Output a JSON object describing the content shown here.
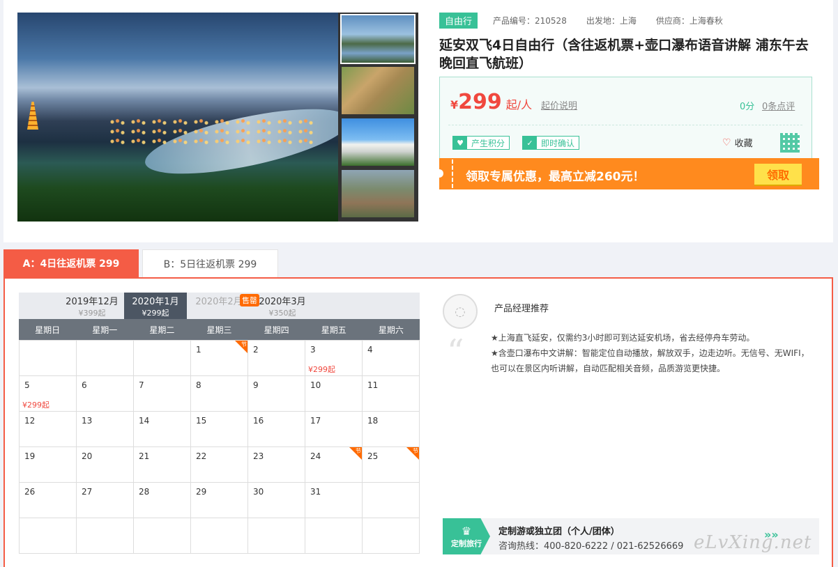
{
  "product": {
    "tag": "自由行",
    "code": "产品编号：210528",
    "departure": "出发地：上海",
    "supplier": "供应商：上海春秋",
    "title": "延安双飞4日自由行（含往返机票+壶口瀑布语音讲解 浦东午去晚回直飞航班）"
  },
  "price": {
    "currency": "¥",
    "amount": "299",
    "unit": "起/人",
    "note": "起价说明",
    "score": "0分",
    "reviews": "0条点评",
    "badge1": "产生积分",
    "badge2": "即时确认",
    "favorite": "收藏"
  },
  "promo": {
    "text": "领取专属优惠，最高立减260元！",
    "button": "领取"
  },
  "tabs": [
    {
      "label": "A：4日往返机票 299"
    },
    {
      "label": "B：5日往返机票 299"
    }
  ],
  "calendar": {
    "months": [
      {
        "label": "2019年12月",
        "price": "¥399起"
      },
      {
        "label": "2020年1月",
        "price": "¥299起"
      },
      {
        "label": "2020年2月",
        "price": ""
      },
      {
        "label": "2020年3月",
        "price": "¥350起"
      }
    ],
    "sold_tag": "售罄",
    "weekdays": [
      "星期日",
      "星期一",
      "星期二",
      "星期三",
      "星期四",
      "星期五",
      "星期六"
    ],
    "holiday_mark": "节",
    "cells": [
      {
        "d": "",
        "p": "",
        "h": false
      },
      {
        "d": "",
        "p": "",
        "h": false
      },
      {
        "d": "",
        "p": "",
        "h": false
      },
      {
        "d": "1",
        "p": "",
        "h": true
      },
      {
        "d": "2",
        "p": "",
        "h": false
      },
      {
        "d": "3",
        "p": "¥299起",
        "h": false
      },
      {
        "d": "4",
        "p": "",
        "h": false
      },
      {
        "d": "5",
        "p": "¥299起",
        "h": false
      },
      {
        "d": "6",
        "p": "",
        "h": false
      },
      {
        "d": "7",
        "p": "",
        "h": false
      },
      {
        "d": "8",
        "p": "",
        "h": false
      },
      {
        "d": "9",
        "p": "",
        "h": false
      },
      {
        "d": "10",
        "p": "",
        "h": false
      },
      {
        "d": "11",
        "p": "",
        "h": false
      },
      {
        "d": "12",
        "p": "",
        "h": false
      },
      {
        "d": "13",
        "p": "",
        "h": false
      },
      {
        "d": "14",
        "p": "",
        "h": false
      },
      {
        "d": "15",
        "p": "",
        "h": false
      },
      {
        "d": "16",
        "p": "",
        "h": false
      },
      {
        "d": "17",
        "p": "",
        "h": false
      },
      {
        "d": "18",
        "p": "",
        "h": false
      },
      {
        "d": "19",
        "p": "",
        "h": false
      },
      {
        "d": "20",
        "p": "",
        "h": false
      },
      {
        "d": "21",
        "p": "",
        "h": false
      },
      {
        "d": "22",
        "p": "",
        "h": false
      },
      {
        "d": "23",
        "p": "",
        "h": false
      },
      {
        "d": "24",
        "p": "",
        "h": true
      },
      {
        "d": "25",
        "p": "",
        "h": true
      },
      {
        "d": "26",
        "p": "",
        "h": false
      },
      {
        "d": "27",
        "p": "",
        "h": false
      },
      {
        "d": "28",
        "p": "",
        "h": false
      },
      {
        "d": "29",
        "p": "",
        "h": false
      },
      {
        "d": "30",
        "p": "",
        "h": false
      },
      {
        "d": "31",
        "p": "",
        "h": false
      },
      {
        "d": "",
        "p": "",
        "h": false
      },
      {
        "d": "",
        "p": "",
        "h": false
      },
      {
        "d": "",
        "p": "",
        "h": false
      },
      {
        "d": "",
        "p": "",
        "h": false
      },
      {
        "d": "",
        "p": "",
        "h": false
      },
      {
        "d": "",
        "p": "",
        "h": false
      },
      {
        "d": "",
        "p": "",
        "h": false
      },
      {
        "d": "",
        "p": "",
        "h": false
      }
    ]
  },
  "manager": {
    "title": "产品经理推荐",
    "line1": "★上海直飞延安，仅需约3小时即可到达延安机场，省去经停舟车劳动。",
    "line2": "★含壶口瀑布中文讲解：智能定位自动播放，解放双手，边走边听。无信号、无WIFI，也可以在景区内听讲解，自动匹配相关音频，品质游览更快捷。"
  },
  "custom": {
    "badge": "定制旅行",
    "title": "定制游或独立团（个人/团体）",
    "phone": "咨询热线：400-820-6222 / 021-62526669"
  },
  "watermark": "eLvXing.net",
  "colors": {
    "accent_green": "#38c197",
    "accent_red": "#f45c45",
    "price_red": "#f0483e",
    "promo_orange": "#ff8a1e"
  }
}
